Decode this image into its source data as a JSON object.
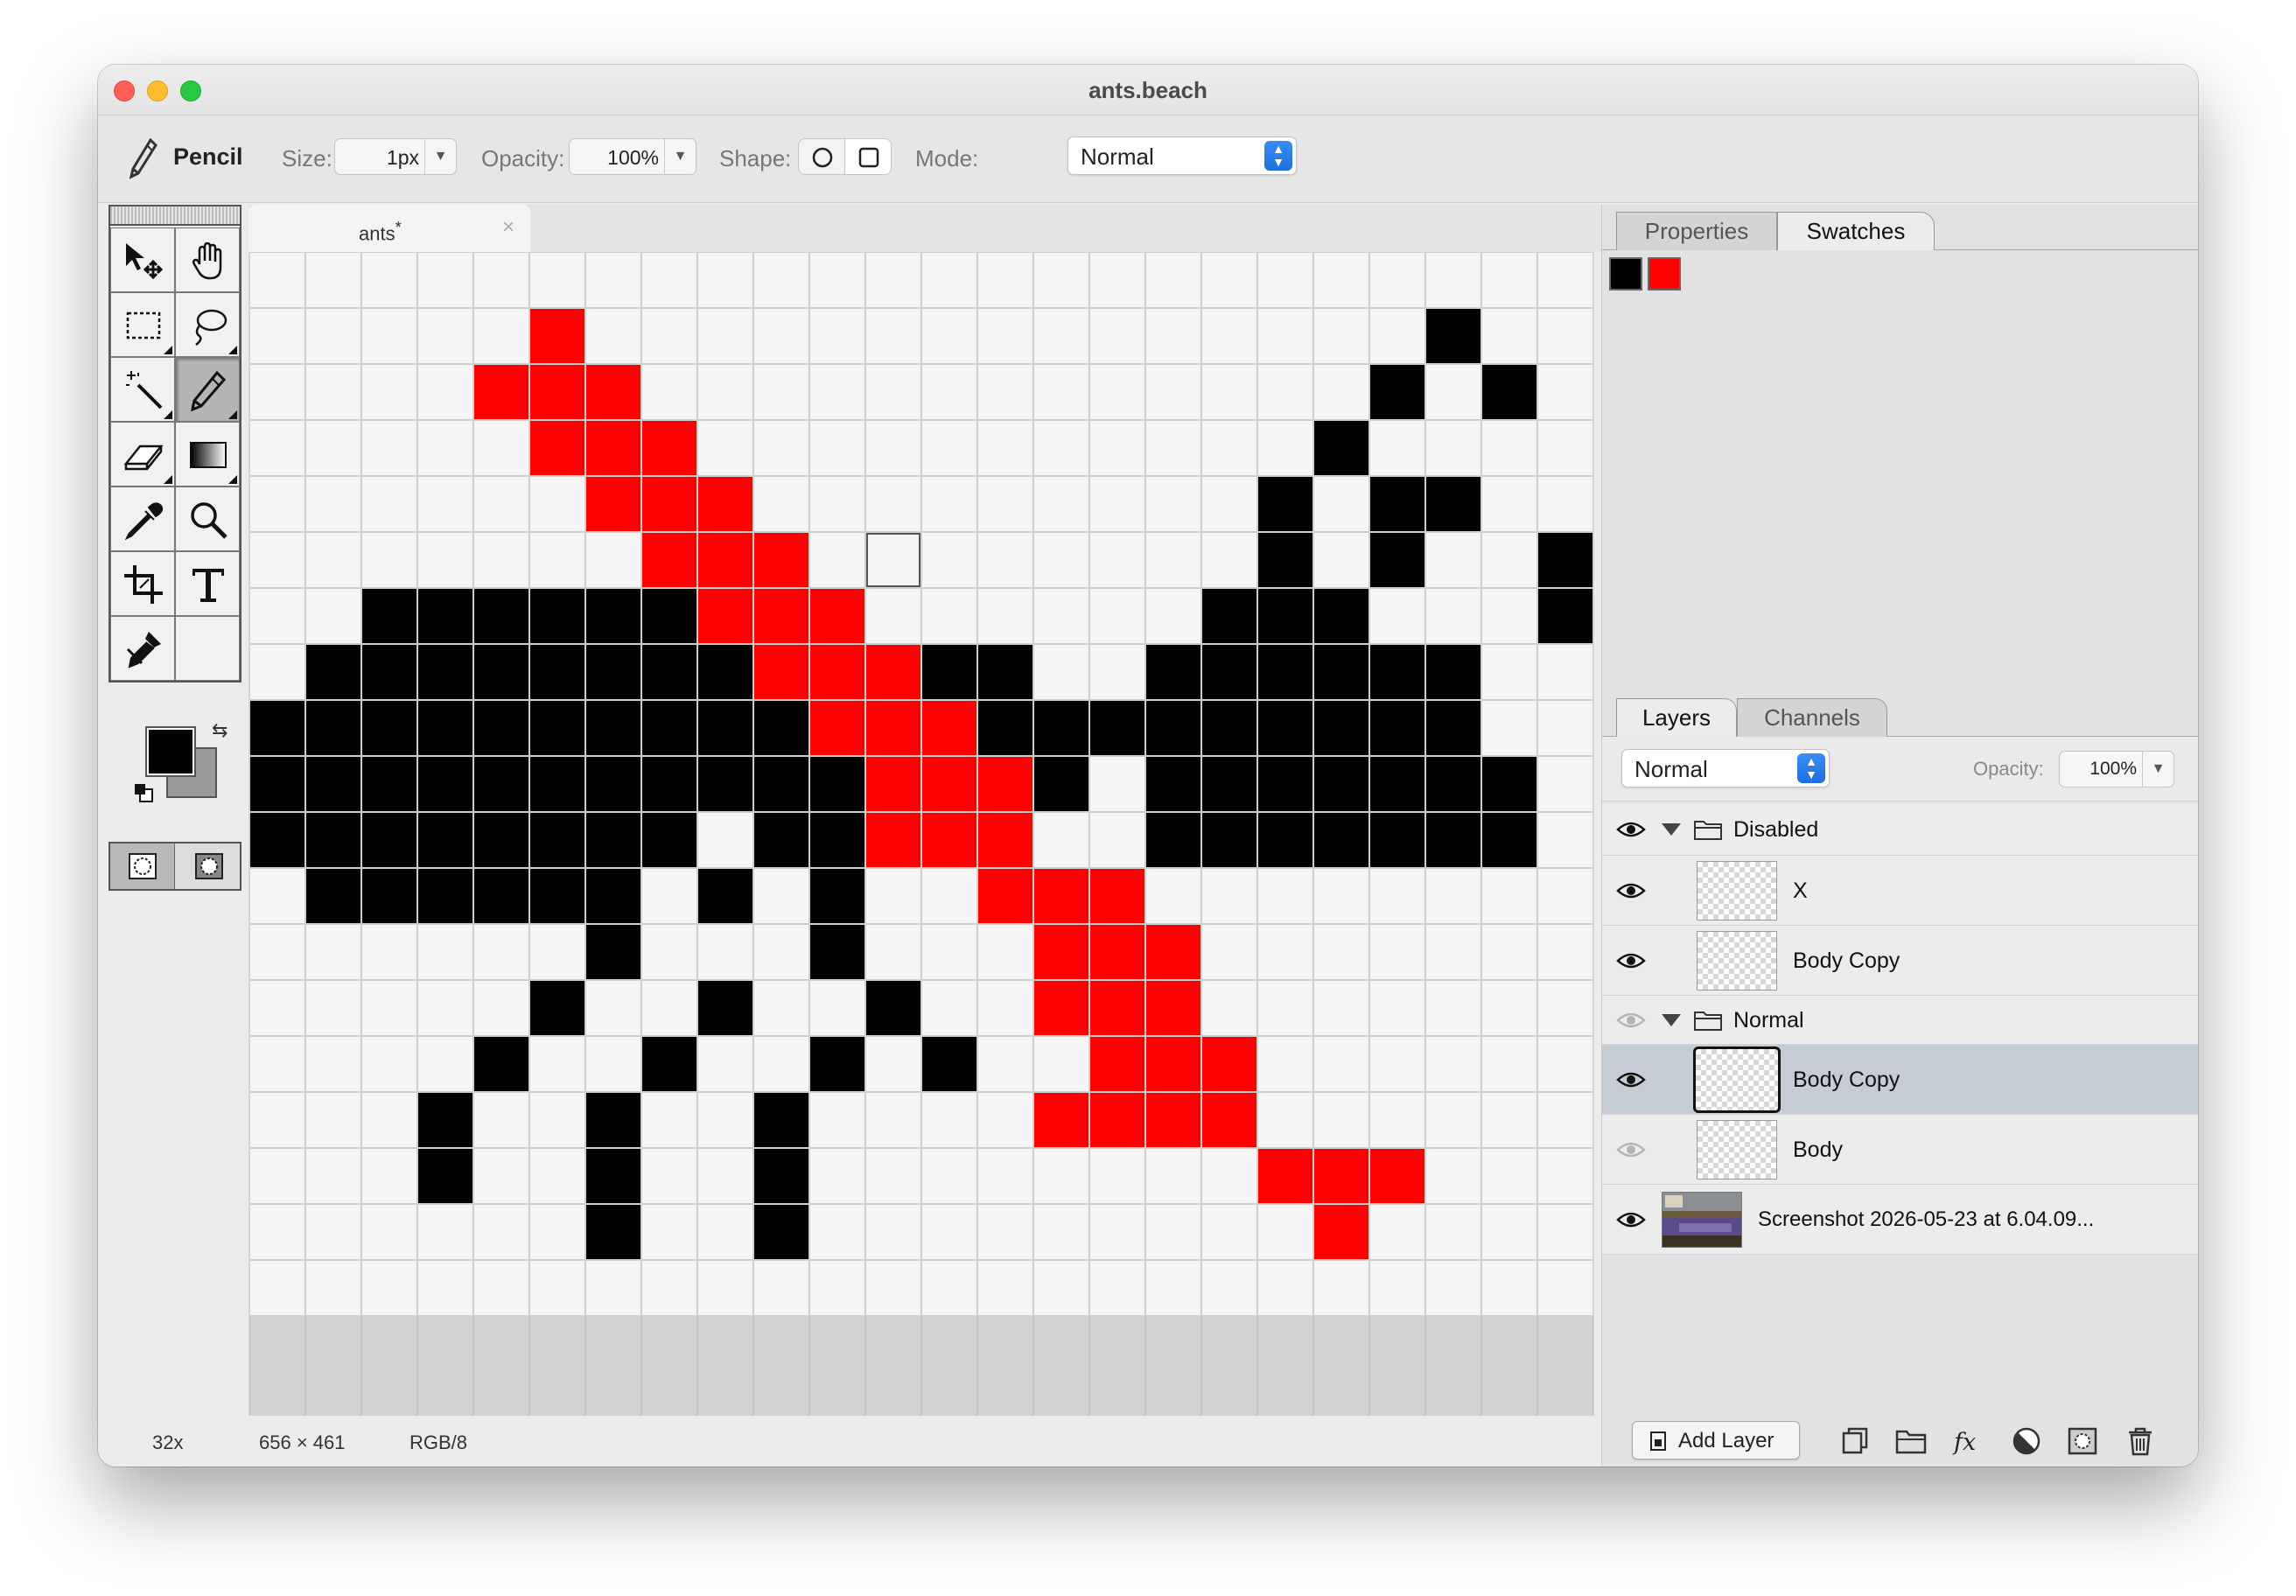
{
  "window": {
    "title": "ants.beach"
  },
  "toolbar": {
    "tool_name": "Pencil",
    "size_label": "Size:",
    "size_value": "1px",
    "opacity_label": "Opacity:",
    "opacity_value": "100%",
    "shape_label": "Shape:",
    "shape_options": [
      "circle",
      "square"
    ],
    "shape_selected": "square",
    "mode_label": "Mode:",
    "mode_value": "Normal"
  },
  "tools": [
    {
      "name": "move-tool",
      "icon": "move-arrow-icon"
    },
    {
      "name": "hand-tool",
      "icon": "hand-icon"
    },
    {
      "name": "marquee-tool",
      "icon": "rect-marquee-icon"
    },
    {
      "name": "lasso-tool",
      "icon": "lasso-icon"
    },
    {
      "name": "magic-wand-tool",
      "icon": "magic-wand-icon"
    },
    {
      "name": "pencil-tool",
      "icon": "pencil-icon",
      "active": true
    },
    {
      "name": "eraser-tool",
      "icon": "eraser-icon"
    },
    {
      "name": "gradient-tool",
      "icon": "gradient-icon"
    },
    {
      "name": "eyedropper-tool",
      "icon": "eyedropper-icon"
    },
    {
      "name": "zoom-tool",
      "icon": "magnifier-icon"
    },
    {
      "name": "crop-tool",
      "icon": "crop-icon"
    },
    {
      "name": "type-tool",
      "icon": "type-icon"
    },
    {
      "name": "clone-tool",
      "icon": "clone-stamp-icon"
    }
  ],
  "colors": {
    "foreground": "#000000",
    "background": "#9a9a9a",
    "accent": "#1c6fe0",
    "paint_red": "#ff0000"
  },
  "document": {
    "tab_name": "ants",
    "modified_mark": "*",
    "zoom": "32x",
    "dimensions": "656 × 461",
    "color_mode": "RGB/8",
    "new_tab_label": "+"
  },
  "canvas": {
    "cols": 24,
    "rows": 19,
    "cursor_cell": [
      11,
      5
    ],
    "pixels": [
      "........................",
      ".....r...............k..",
      "....rrr.............k.k.",
      ".....rrr...........k.....",
      "......rrr.........k.kk..",
      ".......rrr........k.k..k.",
      "..kkkkkkrrr......kkk...k",
      ".kkkkkkkkrrrkk..kkkkkk..",
      "kkkkkkkkkkrrrkkkkkkkkk..",
      "kkkkkkkkkkkrrrk.kkkkkkk.",
      "kkkkkkkk.kkrrr..kkkkkkk.",
      ".kkkkkk.k.k..rrr........",
      "......k...k...rrr.......",
      ".....k..k..k..rrr.......",
      "....k..k..k.k..rrr......",
      "...k..k..k....rrrr......",
      "...k..k..k........rrr...",
      "......k..k.........r....",
      "........................"
    ]
  },
  "panels": {
    "top_tabs": [
      "Properties",
      "Swatches"
    ],
    "top_active": "Swatches",
    "swatches": [
      "#000000",
      "#ff0000"
    ],
    "bottom_tabs": [
      "Layers",
      "Channels"
    ],
    "bottom_active": "Layers",
    "blend_mode": "Normal",
    "opacity_label": "Opacity:",
    "opacity_value": "100%"
  },
  "layers": [
    {
      "type": "group",
      "name": "Disabled",
      "visible": true,
      "expanded": true
    },
    {
      "type": "layer",
      "name": "X",
      "visible": true,
      "indent": true
    },
    {
      "type": "layer",
      "name": "Body Copy",
      "visible": true,
      "indent": true
    },
    {
      "type": "group",
      "name": "Normal",
      "visible": false,
      "expanded": true
    },
    {
      "type": "layer",
      "name": "Body Copy",
      "visible": true,
      "indent": true,
      "selected": true
    },
    {
      "type": "layer",
      "name": "Body",
      "visible": false,
      "indent": true
    },
    {
      "type": "layer",
      "name": "Screenshot 2026-05-23 at 6.04.09...",
      "visible": true,
      "indent": false
    }
  ],
  "layers_footer": {
    "add_layer_label": "Add Layer",
    "icons": [
      "duplicate-layer-icon",
      "new-group-icon",
      "fx-icon",
      "adjustment-icon",
      "mask-icon",
      "trash-icon"
    ]
  }
}
